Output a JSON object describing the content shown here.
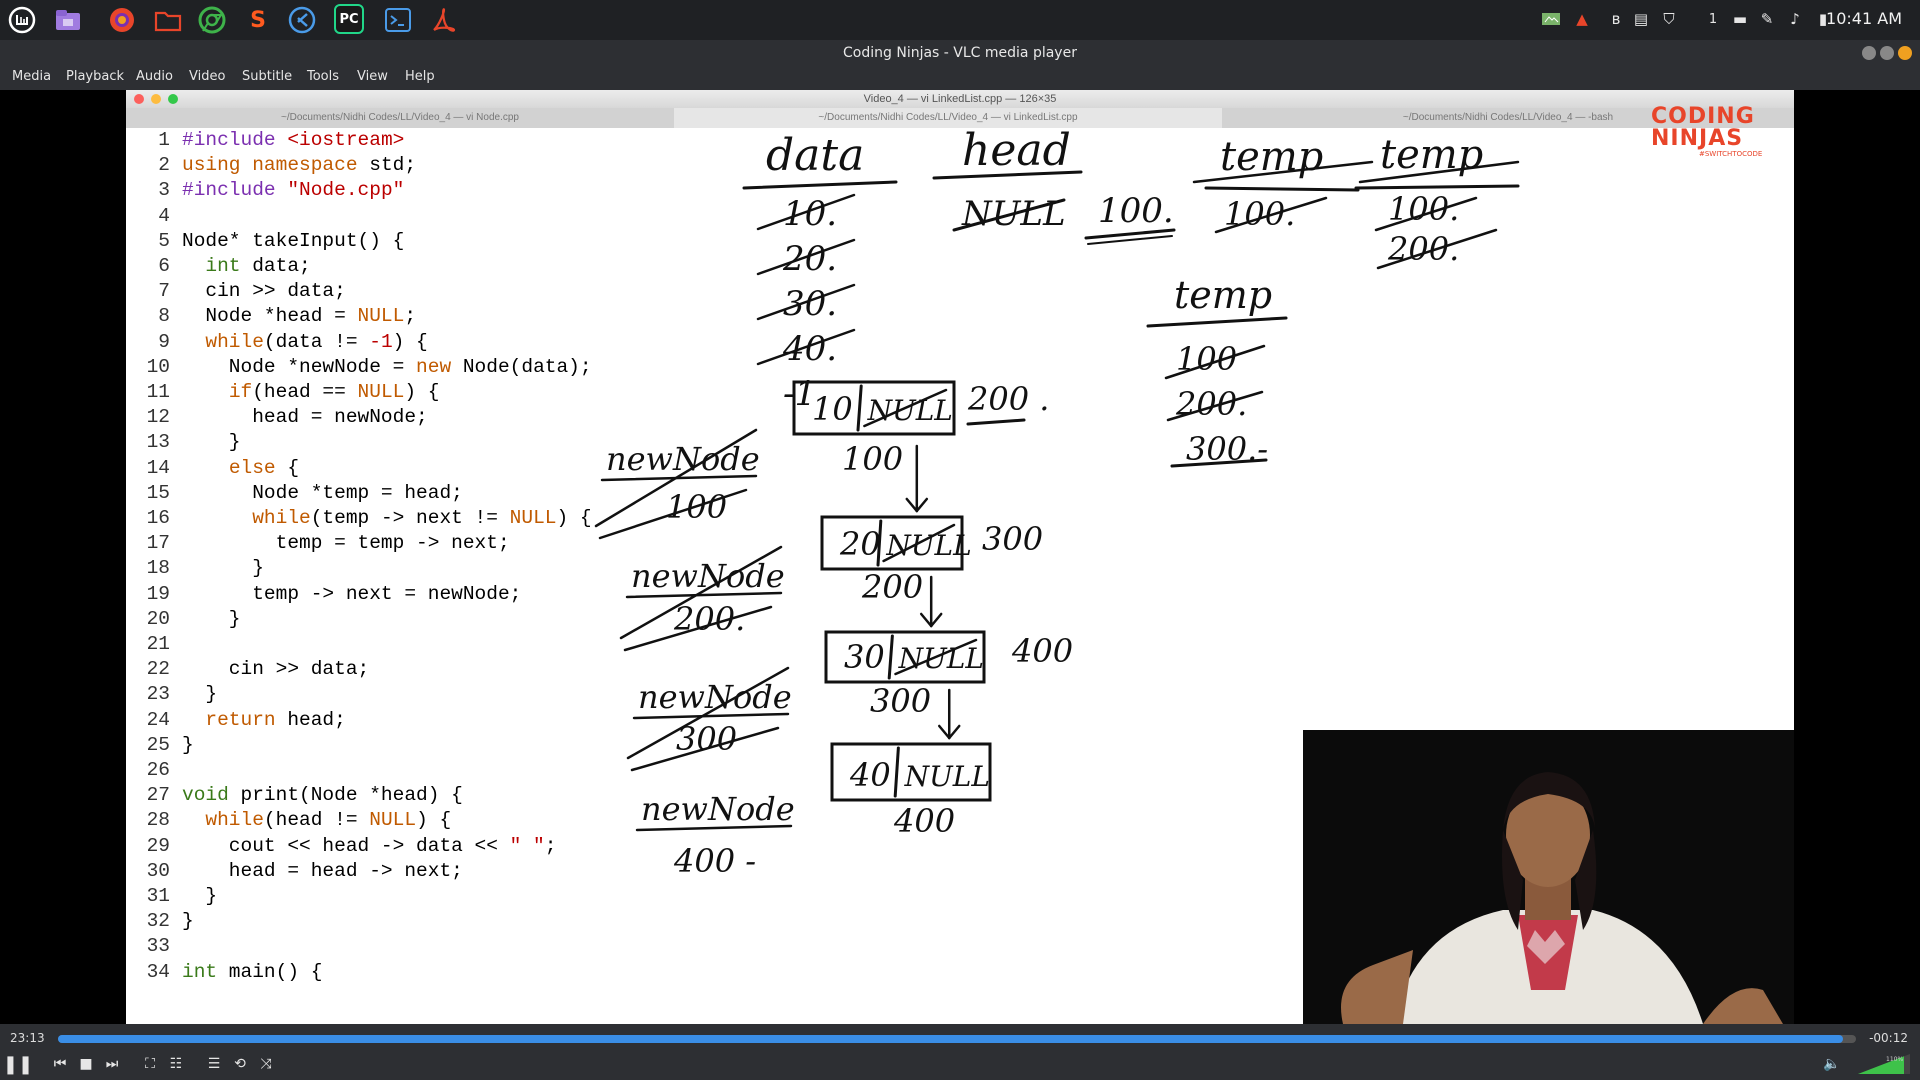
{
  "clock": "10:41 AM",
  "tray_badge": "1",
  "taskbar": {
    "launchers": [
      "mint-menu-icon",
      "files-icon",
      "firefox-icon",
      "folder-icon",
      "chrome-icon",
      "sublime-icon",
      "vscode-icon",
      "pycharm-icon",
      "terminal-icon",
      "acrobat-icon"
    ]
  },
  "vlc": {
    "title": "Coding Ninjas - VLC media player",
    "menu": [
      "Media",
      "Playback",
      "Audio",
      "Video",
      "Subtitle",
      "Tools",
      "View",
      "Help"
    ]
  },
  "terminal": {
    "title": "Video_4 — vi LinkedList.cpp — 126×35",
    "tabs": [
      "~/Documents/Nidhi Codes/LL/Video_4 — vi Node.cpp",
      "~/Documents/Nidhi Codes/LL/Video_4 — vi LinkedList.cpp",
      "~/Documents/Nidhi Codes/LL/Video_4 — -bash"
    ]
  },
  "code": [
    {
      "n": "1",
      "t": "#include <iostream>"
    },
    {
      "n": "2",
      "t": "using namespace std;"
    },
    {
      "n": "3",
      "t": "#include \"Node.cpp\""
    },
    {
      "n": "4",
      "t": ""
    },
    {
      "n": "5",
      "t": "Node* takeInput() {"
    },
    {
      "n": "6",
      "t": "  int data;"
    },
    {
      "n": "7",
      "t": "  cin >> data;"
    },
    {
      "n": "8",
      "t": "  Node *head = NULL;"
    },
    {
      "n": "9",
      "t": "  while(data != -1) {"
    },
    {
      "n": "10",
      "t": "    Node *newNode = new Node(data);"
    },
    {
      "n": "11",
      "t": "    if(head == NULL) {"
    },
    {
      "n": "12",
      "t": "      head = newNode;"
    },
    {
      "n": "13",
      "t": "    }"
    },
    {
      "n": "14",
      "t": "    else {"
    },
    {
      "n": "15",
      "t": "      Node *temp = head;"
    },
    {
      "n": "16",
      "t": "      while(temp -> next != NULL) {"
    },
    {
      "n": "17",
      "t": "        temp = temp -> next;"
    },
    {
      "n": "18",
      "t": "      }"
    },
    {
      "n": "19",
      "t": "      temp -> next = newNode;"
    },
    {
      "n": "20",
      "t": "    }"
    },
    {
      "n": "21",
      "t": ""
    },
    {
      "n": "22",
      "t": "    cin >> data;"
    },
    {
      "n": "23",
      "t": "  }"
    },
    {
      "n": "24",
      "t": "  return head;"
    },
    {
      "n": "25",
      "t": "}"
    },
    {
      "n": "26",
      "t": ""
    },
    {
      "n": "27",
      "t": "void print(Node *head) {"
    },
    {
      "n": "28",
      "t": "  while(head != NULL) {"
    },
    {
      "n": "29",
      "t": "    cout << head -> data << \" \";"
    },
    {
      "n": "30",
      "t": "    head = head -> next;"
    },
    {
      "n": "31",
      "t": "  }"
    },
    {
      "n": "32",
      "t": "}"
    },
    {
      "n": "33",
      "t": ""
    },
    {
      "n": "34",
      "t": "int main() {"
    }
  ],
  "notes": {
    "data_hdr": "data",
    "data_vals": [
      "10.",
      "20.",
      "30.",
      "40.",
      "-1"
    ],
    "head_hdr": "head",
    "head_val": "NULL",
    "head_new": "100.",
    "temp1_hdr": "temp",
    "temp1_val": "100.",
    "temp2_hdr": "temp",
    "temp2_vals": [
      "100.",
      "200."
    ],
    "temp3_hdr": "temp",
    "temp3_vals": [
      "100",
      "200.",
      "300.-"
    ],
    "newnode1": [
      "newNode",
      "100"
    ],
    "newnode2": [
      "newNode",
      "200."
    ],
    "newnode3": [
      "newNode",
      "300"
    ],
    "newnode4": [
      "newNode",
      "400 -"
    ],
    "nodes": [
      {
        "data": "10",
        "next": "NULL",
        "addr": "100",
        "nextaddr": "200 ."
      },
      {
        "data": "20",
        "next": "NULL",
        "addr": "200",
        "nextaddr": "300"
      },
      {
        "data": "30",
        "next": "NULL",
        "addr": "300",
        "nextaddr": "400"
      },
      {
        "data": "40",
        "next": "NULL",
        "addr": "400",
        "nextaddr": ""
      }
    ]
  },
  "logo": {
    "line1": "CODING",
    "line2": "NINJAS",
    "tag": "#SWITCHTOCODE"
  },
  "player": {
    "elapsed": "23:13",
    "remaining": "-00:12",
    "progress": 0.993,
    "volume": "110%"
  }
}
